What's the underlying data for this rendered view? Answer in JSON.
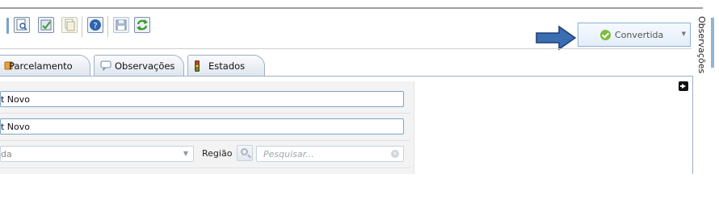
{
  "status": {
    "label": "Convertida"
  },
  "side_panel": {
    "title": "Observações"
  },
  "tabs": [
    {
      "label": "Parcelamento",
      "icon": "money-icon"
    },
    {
      "label": "Observações",
      "icon": "comment-icon"
    },
    {
      "label": "Estados",
      "icon": "traffic-light-icon"
    }
  ],
  "form": {
    "field1_value": "t Novo",
    "field2_value": "t Novo",
    "field3_value": "da",
    "regiao_label": "Região",
    "search_placeholder": "Pesquisar..."
  },
  "toolbar_icons": [
    "preview-icon",
    "approve-icon",
    "copy-icon",
    "help-icon",
    "save-icon",
    "refresh-icon"
  ],
  "colors": {
    "accent_blue": "#3b6db3",
    "status_check": "#7cbd3d"
  }
}
